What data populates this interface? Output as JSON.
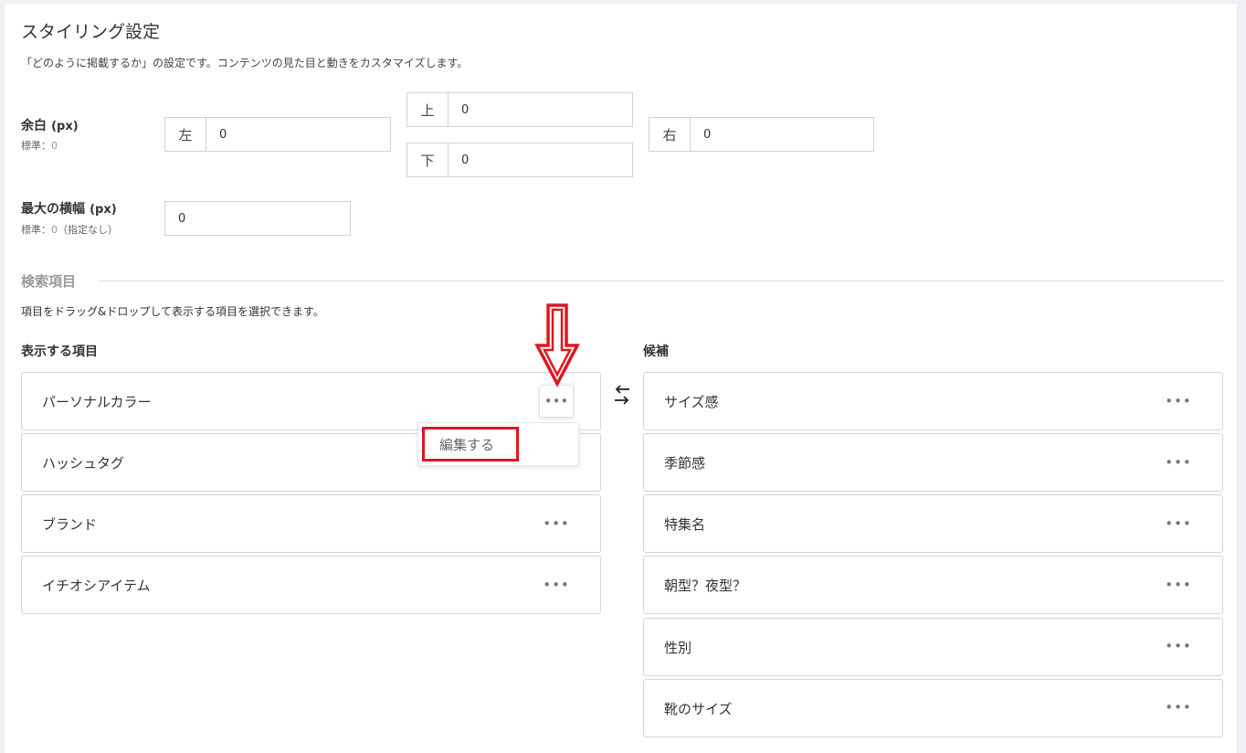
{
  "header": {
    "title": "スタイリング設定",
    "description": "「どのように掲載するか」の設定です。コンテンツの見た目と動きをカスタマイズします。"
  },
  "margin": {
    "label": "余白",
    "unit": "(px)",
    "hint_prefix": "標準：",
    "hint_value": "0",
    "left": {
      "addon": "左",
      "value": "0"
    },
    "top": {
      "addon": "上",
      "value": "0"
    },
    "bottom": {
      "addon": "下",
      "value": "0"
    },
    "right": {
      "addon": "右",
      "value": "0"
    }
  },
  "max_width": {
    "label": "最大の横幅",
    "unit": "(px)",
    "hint_prefix": "標準：",
    "hint_value": "0",
    "hint_suffix": "（指定なし）",
    "value": "0"
  },
  "search_items": {
    "section_title": "検索項目",
    "description": "項目をドラッグ&ドロップして表示する項目を選択できます。",
    "displayed_heading": "表示する項目",
    "candidates_heading": "候補",
    "displayed": [
      "パーソナルカラー",
      "ハッシュタグ",
      "ブランド",
      "イチオシアイテム"
    ],
    "candidates": [
      "サイズ感",
      "季節感",
      "特集名",
      "朝型？夜型？",
      "性別",
      "靴のサイズ"
    ],
    "more_glyph": "•••",
    "menu_edit": "編集する"
  },
  "colors": {
    "annotation_red": "#e0161f",
    "border": "#d6d6d6",
    "muted_heading": "#999999"
  },
  "icons": {
    "swap": "swap-arrows-icon",
    "more": "more-horizontal-icon",
    "annotation": "down-arrow-annotation"
  }
}
